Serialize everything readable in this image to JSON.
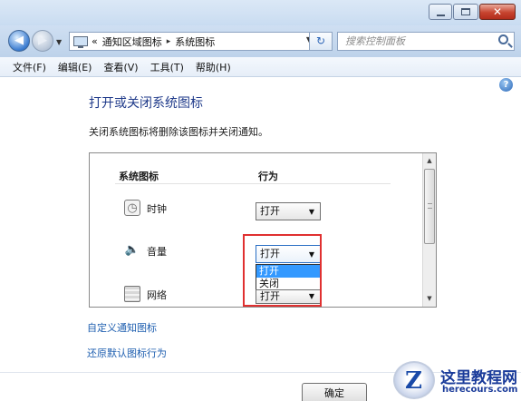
{
  "window": {
    "controls": {
      "min": "minimize",
      "max": "maximize",
      "close": "✕"
    }
  },
  "nav": {
    "back_glyph": "◀",
    "forward_glyph": "▶",
    "breadcrumb": [
      "«",
      "通知区域图标",
      "▸",
      "系统图标"
    ],
    "search_placeholder": "搜索控制面板"
  },
  "menu": {
    "items": [
      "文件(F)",
      "编辑(E)",
      "查看(V)",
      "工具(T)",
      "帮助(H)"
    ]
  },
  "content": {
    "title": "打开或关闭系统图标",
    "description": "关闭系统图标将删除该图标并关闭通知。",
    "table": {
      "col_icon": "系统图标",
      "col_behavior": "行为",
      "rows": [
        {
          "label": "时钟",
          "icon": "clock-icon",
          "value": "打开"
        },
        {
          "label": "音量",
          "icon": "volume-icon",
          "value": "打开"
        },
        {
          "label": "网络",
          "icon": "network-icon",
          "value": "打开"
        }
      ],
      "dropdown_options": [
        "打开",
        "关闭"
      ]
    },
    "links": [
      "自定义通知图标",
      "还原默认图标行为"
    ],
    "ok_button": "确定"
  },
  "watermark": {
    "letter": "Z",
    "title": "这里教程网",
    "url": "herecours.com"
  },
  "colors": {
    "accent": "#1f3a8a",
    "link": "#1f5fb0",
    "highlight": "#e03030",
    "selection": "#3399ff"
  }
}
